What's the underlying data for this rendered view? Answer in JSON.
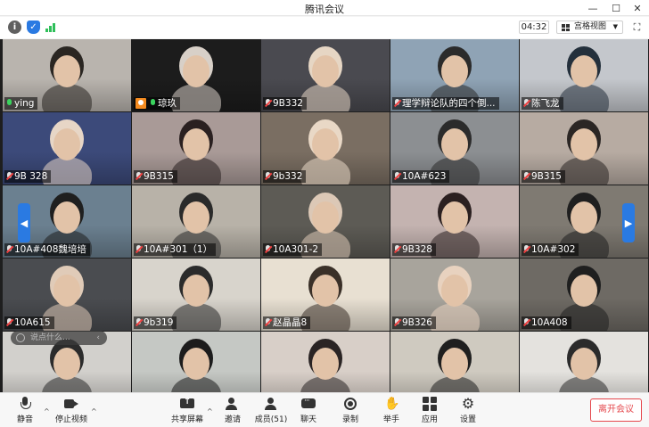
{
  "window": {
    "title": "腾讯会议",
    "controls": {
      "minimize": "—",
      "maximize": "☐",
      "close": "✕"
    }
  },
  "infobar": {
    "icons": [
      "info-icon",
      "shield-icon",
      "signal-icon"
    ],
    "timer": "04:32",
    "view_mode": "宫格视图",
    "fullscreen_icon": "fullscreen-icon"
  },
  "participants": [
    {
      "name": "ying",
      "mic": "on",
      "active": true,
      "bg": "#b9b4ae",
      "fg": "#2a2622"
    },
    {
      "name": "琼玖",
      "mic": "on",
      "avatar": true,
      "bg": "#1c1c1c",
      "fg": "#d8d0c8"
    },
    {
      "name": "9B332",
      "mic": "muted",
      "bg": "#4a4a50",
      "fg": "#e6d6c4"
    },
    {
      "name": "理学辩论队的四个倒...",
      "mic": "muted",
      "bg": "#8fa3b5",
      "fg": "#2b2b2b"
    },
    {
      "name": "陈飞龙",
      "mic": "muted",
      "bg": "#c4c7cc",
      "fg": "#24303c"
    },
    {
      "name": "9B 328",
      "mic": "muted",
      "bg": "#3c4a7a",
      "fg": "#e7d6c6"
    },
    {
      "name": "9B315",
      "mic": "muted",
      "bg": "#a99a97",
      "fg": "#2a2020"
    },
    {
      "name": "9b332",
      "mic": "muted",
      "bg": "#7a6e62",
      "fg": "#e9d8c6"
    },
    {
      "name": "10A#623",
      "mic": "muted",
      "bg": "#8c8f92",
      "fg": "#2b2b2b"
    },
    {
      "name": "9B315",
      "mic": "muted",
      "bg": "#b7aba2",
      "fg": "#2b2624"
    },
    {
      "name": "10A#408魏培培",
      "mic": "muted",
      "bg": "#6b8090",
      "fg": "#1f1f1f"
    },
    {
      "name": "10A#301（1）",
      "mic": "muted",
      "bg": "#b8b2a8",
      "fg": "#2a2a2a"
    },
    {
      "name": "10A301-2",
      "mic": "muted",
      "bg": "#5d5b55",
      "fg": "#dcc8b6"
    },
    {
      "name": "9B328",
      "mic": "muted",
      "bg": "#c4b3b0",
      "fg": "#2b2020"
    },
    {
      "name": "10A#302",
      "mic": "muted",
      "bg": "#7f7a72",
      "fg": "#1f1f1f"
    },
    {
      "name": "10A615",
      "mic": "muted",
      "bg": "#4a4c50",
      "fg": "#e0cbb8"
    },
    {
      "name": "9b319",
      "mic": "muted",
      "bg": "#d8d4cc",
      "fg": "#2b2b2b"
    },
    {
      "name": "赵晶晶8",
      "mic": "muted",
      "bg": "#e8e0d2",
      "fg": "#3a3028"
    },
    {
      "name": "9B326",
      "mic": "muted",
      "bg": "#a8a49c",
      "fg": "#e8d2bf"
    },
    {
      "name": "10A408",
      "mic": "muted",
      "bg": "#6e6a64",
      "fg": "#1f1f1f"
    },
    {
      "name": "",
      "mic": "none",
      "bg": "#d2d0cc",
      "fg": "#2b2b2b"
    },
    {
      "name": "",
      "mic": "none",
      "bg": "#c5c8c4",
      "fg": "#1c1c1c"
    },
    {
      "name": "",
      "mic": "none",
      "bg": "#d8cfc8",
      "fg": "#2a2424"
    },
    {
      "name": "",
      "mic": "none",
      "bg": "#cfcac0",
      "fg": "#1f1f1f"
    },
    {
      "name": "",
      "mic": "none",
      "bg": "#e4e2de",
      "fg": "#2b2b2b"
    }
  ],
  "floating": {
    "placeholder": "说点什么..."
  },
  "toolbar": {
    "mute": "静音",
    "stop_video": "停止视频",
    "share_screen": "共享屏幕",
    "invite": "邀请",
    "members": "成员(51)",
    "chat": "聊天",
    "record": "录制",
    "raise_hand": "举手",
    "apps": "应用",
    "settings": "设置",
    "leave": "离开会议"
  },
  "colors": {
    "accent": "#2a7ae2",
    "active_speaker": "#3ad35d",
    "muted_mic": "#f04040",
    "leave": "#e5484d"
  }
}
